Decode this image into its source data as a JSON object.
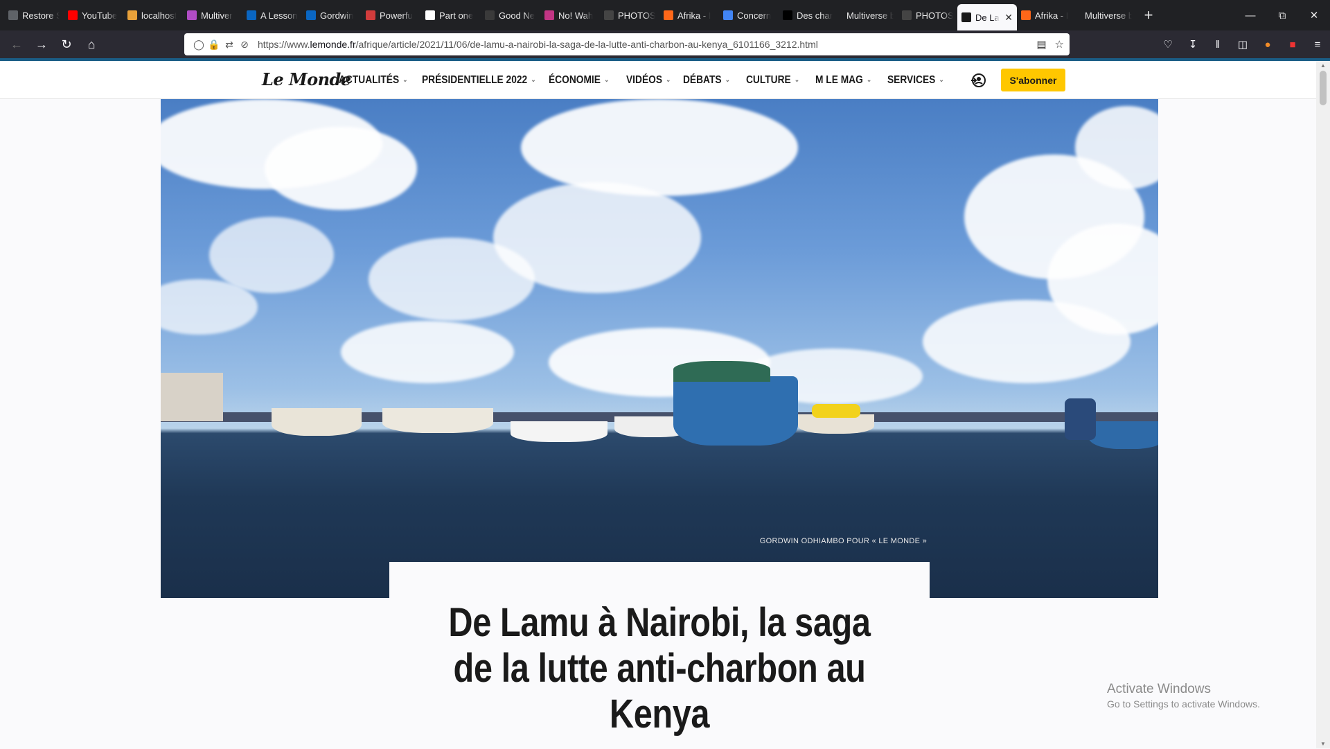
{
  "browser": {
    "tabs": [
      {
        "title": "Restore S",
        "icon": "info-icon",
        "color": "#5f6368"
      },
      {
        "title": "YouTube",
        "icon": "youtube-icon",
        "color": "#ff0000"
      },
      {
        "title": "localhost",
        "icon": "localhost-icon",
        "color": "#e8a13a"
      },
      {
        "title": "Multiver",
        "icon": "multiverse-icon",
        "color": "#b04cc4"
      },
      {
        "title": "A Lesson",
        "icon": "linkedin-icon",
        "color": "#0a66c2"
      },
      {
        "title": "Gordwin",
        "icon": "linkedin-icon",
        "color": "#0a66c2"
      },
      {
        "title": "Powerfu",
        "icon": "powerful-icon",
        "color": "#d23c3c"
      },
      {
        "title": "Part one",
        "icon": "page-icon",
        "color": "#ffffff"
      },
      {
        "title": "Good Ne",
        "icon": "gnn-icon",
        "color": "#3a3a3a"
      },
      {
        "title": "No! Wah",
        "icon": "instagram-icon",
        "color": "#c13584"
      },
      {
        "title": "PHOTOS",
        "icon": "photos-icon",
        "color": "#444444"
      },
      {
        "title": "Afrika - I",
        "icon": "substack-icon",
        "color": "#ff6719"
      },
      {
        "title": "Concern",
        "icon": "google-icon",
        "color": "#4285f4"
      },
      {
        "title": "Des char",
        "icon": "forbes-icon",
        "color": "#000000"
      },
      {
        "title": "Multiverse b",
        "icon": "none",
        "color": "#202124"
      },
      {
        "title": "PHOTOS",
        "icon": "photos-icon",
        "color": "#444444"
      },
      {
        "title": "De La",
        "icon": "lemonde-icon",
        "color": "#1a1a1a",
        "active": true
      },
      {
        "title": "Afrika - I",
        "icon": "substack-icon",
        "color": "#ff6719"
      },
      {
        "title": "Multiverse b",
        "icon": "none",
        "color": "#202124"
      }
    ],
    "url_prefix": "https://www.",
    "url_domain": "lemonde.fr",
    "url_path": "/afrique/article/2021/11/06/de-lamu-a-nairobi-la-saga-de-la-lutte-anti-charbon-au-kenya_6101166_3212.html"
  },
  "site": {
    "logo": "Le Monde",
    "menu": [
      "ACTUALITÉS",
      "PRÉSIDENTIELLE 2022",
      "ÉCONOMIE",
      "VIDÉOS",
      "DÉBATS",
      "CULTURE",
      "M LE MAG",
      "SERVICES"
    ],
    "subscribe_label": "S'abonner"
  },
  "article": {
    "photo_credit": "GORDWIN ODHIAMBO POUR « LE MONDE »",
    "title": "De Lamu à Nairobi, la saga de la lutte anti-charbon au Kenya"
  },
  "os": {
    "activate_title": "Activate Windows",
    "activate_sub": "Go to Settings to activate Windows."
  }
}
